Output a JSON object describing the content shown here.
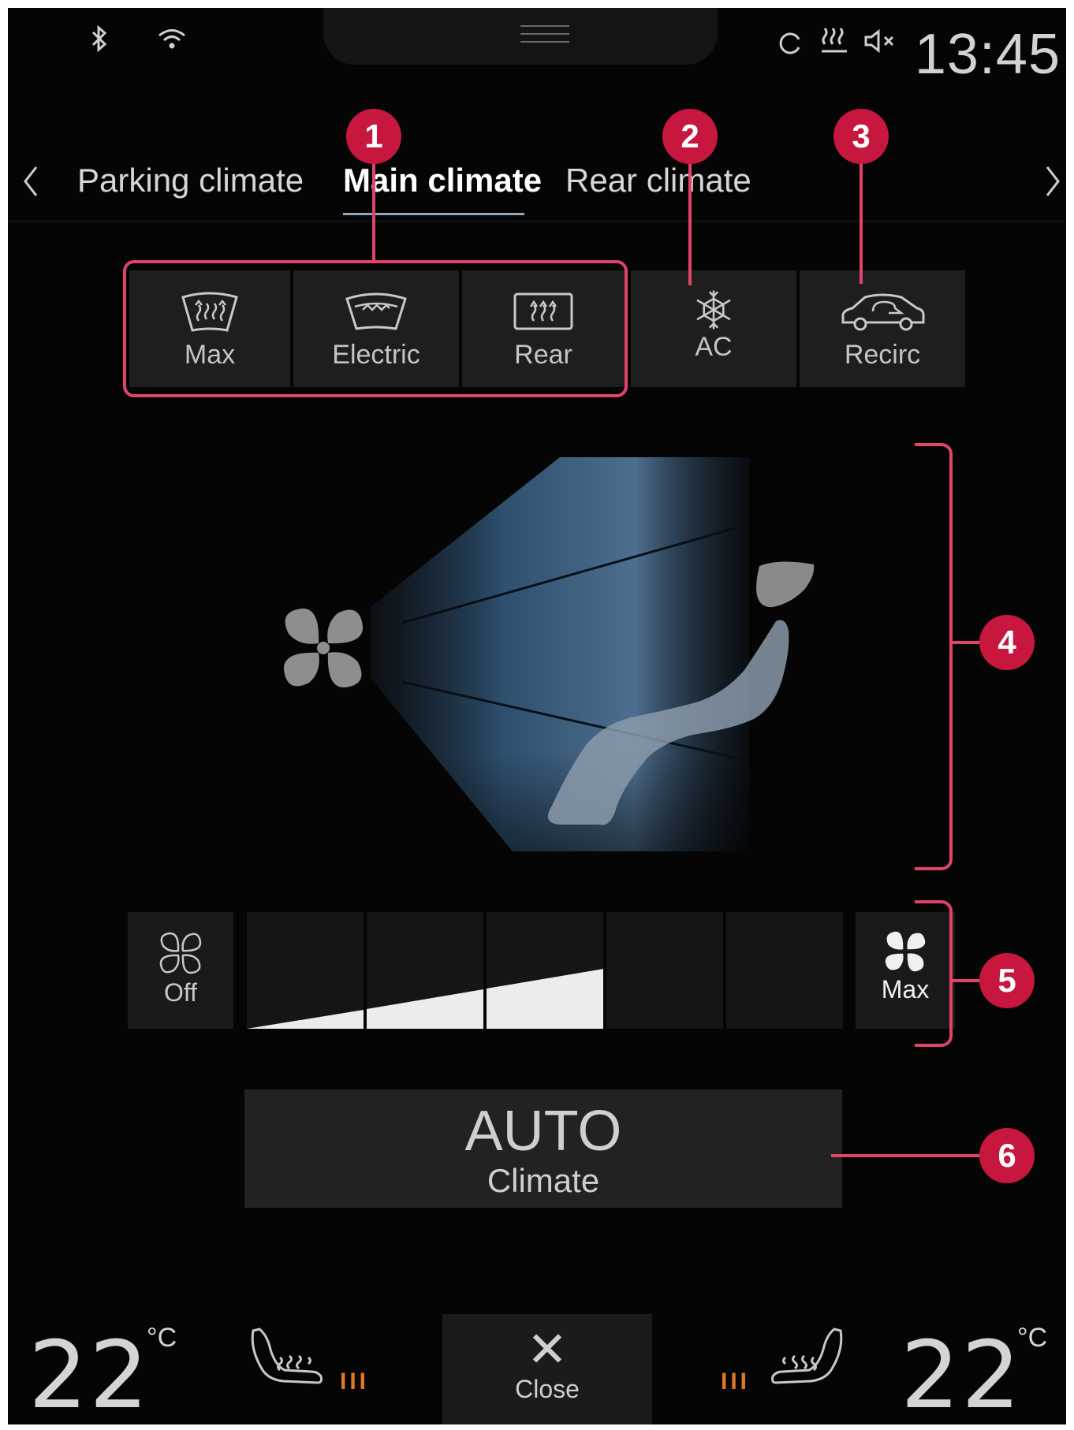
{
  "status_bar": {
    "icons": [
      "bluetooth-icon",
      "wifi-icon",
      "sync-icon",
      "seat-heating-status-icon",
      "mute-icon"
    ],
    "time": "13:45"
  },
  "tabs": [
    {
      "label": "Parking climate",
      "active": false
    },
    {
      "label": "Main climate",
      "active": true
    },
    {
      "label": "Rear climate",
      "active": false
    }
  ],
  "functions": {
    "defrost_max": "Max",
    "defrost_electric": "Electric",
    "defrost_rear": "Rear",
    "ac": "AC",
    "recirc": "Recirc"
  },
  "callouts": [
    "1",
    "2",
    "3",
    "4",
    "5",
    "6"
  ],
  "fan": {
    "off_label": "Off",
    "max_label": "Max",
    "levels_total": 6,
    "level_active": 3
  },
  "auto": {
    "title": "AUTO",
    "subtitle": "Climate"
  },
  "bottom_bar": {
    "left_temp": "22",
    "left_unit": "°C",
    "left_seat_heat": "III",
    "close_label": "Close",
    "right_seat_heat": "III",
    "right_temp": "22",
    "right_unit": "°C"
  },
  "colors": {
    "callout": "#e0446b",
    "badge": "#c8173f",
    "seat_heat_level": "#e07a1d",
    "tab_underline": "#93a9bf"
  }
}
